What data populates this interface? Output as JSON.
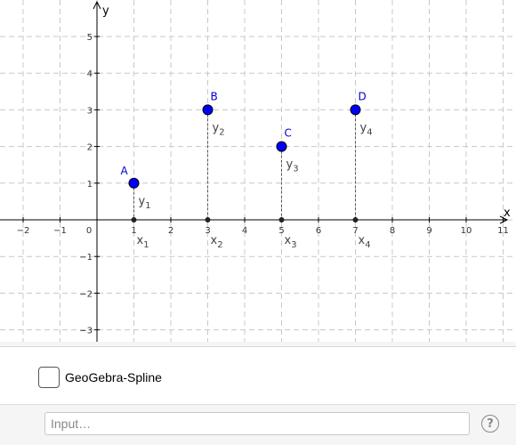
{
  "graph": {
    "x_axis_label": "x",
    "y_axis_label": "y",
    "x_ticks": [
      "−2",
      "−1",
      "0",
      "1",
      "2",
      "3",
      "4",
      "5",
      "6",
      "7",
      "8",
      "9",
      "10",
      "11"
    ],
    "x_tick_values": [
      -2,
      -1,
      0,
      1,
      2,
      3,
      4,
      5,
      6,
      7,
      8,
      9,
      10,
      11
    ],
    "y_ticks": [
      "5",
      "4",
      "3",
      "2",
      "1",
      "−1",
      "−2",
      "−3"
    ],
    "y_tick_values": [
      5,
      4,
      3,
      2,
      1,
      -1,
      -2,
      -3
    ],
    "points": [
      {
        "name": "A",
        "x": 1,
        "y": 1,
        "x_label": "x",
        "x_sub": "1",
        "y_label": "y",
        "y_sub": "1"
      },
      {
        "name": "B",
        "x": 3,
        "y": 3,
        "x_label": "x",
        "x_sub": "2",
        "y_label": "y",
        "y_sub": "2"
      },
      {
        "name": "C",
        "x": 5,
        "y": 2,
        "x_label": "x",
        "x_sub": "3",
        "y_label": "y",
        "y_sub": "3"
      },
      {
        "name": "D",
        "x": 7,
        "y": 3,
        "x_label": "x",
        "x_sub": "4",
        "y_label": "y",
        "y_sub": "4"
      }
    ],
    "colors": {
      "point": "#0000ff",
      "grid": "#c8c8c8",
      "axis": "#000000"
    }
  },
  "controls": {
    "checkbox_label": "GeoGebra-Spline",
    "checkbox_checked": false
  },
  "input_bar": {
    "placeholder": "Input…",
    "help_icon": "help-icon",
    "help_glyph": "?"
  }
}
